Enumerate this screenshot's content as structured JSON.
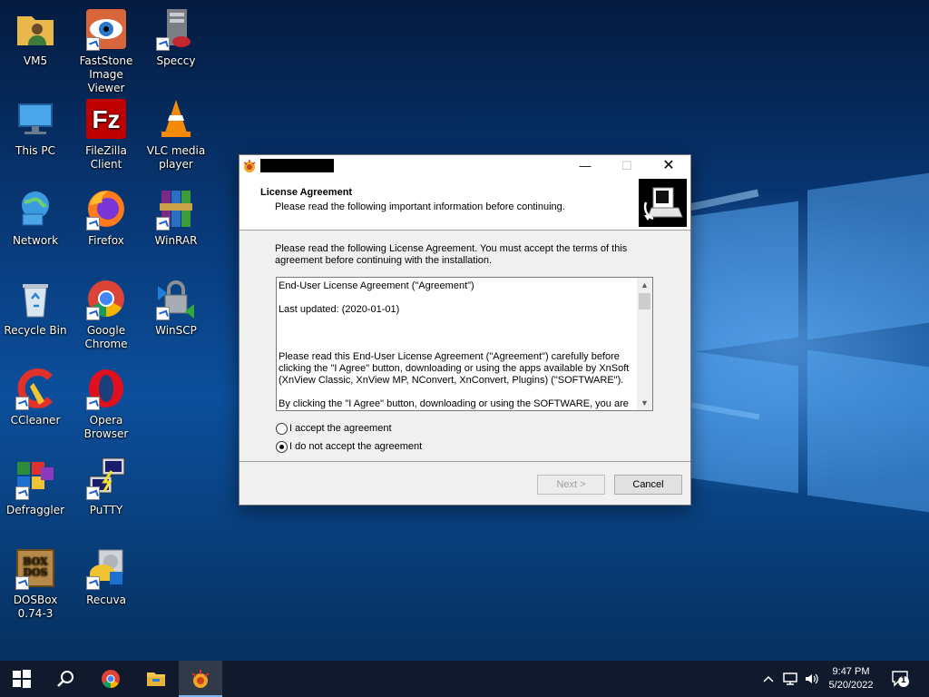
{
  "desktop_icons": [
    {
      "label": "VM5",
      "icon": "folder-user-icon"
    },
    {
      "label": "FastStone\nImage Viewer",
      "icon": "faststone-eye-icon"
    },
    {
      "label": "Speccy",
      "icon": "speccy-icon"
    },
    {
      "label": "This PC",
      "icon": "this-pc-icon"
    },
    {
      "label": "FileZilla Client",
      "icon": "filezilla-icon"
    },
    {
      "label": "VLC media\nplayer",
      "icon": "vlc-cone-icon"
    },
    {
      "label": "Network",
      "icon": "network-globe-icon"
    },
    {
      "label": "Firefox",
      "icon": "firefox-icon"
    },
    {
      "label": "WinRAR",
      "icon": "winrar-books-icon"
    },
    {
      "label": "Recycle Bin",
      "icon": "recycle-bin-icon"
    },
    {
      "label": "Google\nChrome",
      "icon": "chrome-icon"
    },
    {
      "label": "WinSCP",
      "icon": "winscp-lock-icon"
    },
    {
      "label": "CCleaner",
      "icon": "ccleaner-icon"
    },
    {
      "label": "Opera\nBrowser",
      "icon": "opera-icon"
    },
    {
      "label": "Defraggler",
      "icon": "defraggler-icon"
    },
    {
      "label": "PuTTY",
      "icon": "putty-icon"
    },
    {
      "label": "DOSBox\n0.74-3",
      "icon": "dosbox-icon"
    },
    {
      "label": "Recuva",
      "icon": "recuva-icon"
    }
  ],
  "installer": {
    "title_redacted": true,
    "header_title": "License Agreement",
    "header_subtitle": "Please read the following important information before continuing.",
    "intro": "Please read the following License Agreement. You must accept the terms of this agreement before continuing with the installation.",
    "license_paragraphs": [
      "End-User License Agreement (\"Agreement\")",
      "Last updated: (2020-01-01)",
      "",
      "Please read this End-User License Agreement (\"Agreement\") carefully before clicking the \"I Agree\" button, downloading or using the apps available by XnSoft (XnView Classic, XnView MP, NConvert, XnConvert, Plugins) (\"SOFTWARE\").",
      "By clicking the \"I Agree\" button, downloading or using the SOFTWARE, you are agreeing to be bound by the terms and conditions of this Agreement."
    ],
    "radio_accept": "I accept the agreement",
    "radio_decline": "I do not accept the agreement",
    "selected_option": "decline",
    "next_label": "Next >",
    "cancel_label": "Cancel",
    "close_glyph": "✕",
    "minimize_glyph": "—",
    "maximize_glyph": "☐"
  },
  "taskbar": {
    "items": [
      "start-icon",
      "search-icon",
      "chrome-icon",
      "file-explorer-icon",
      "installer-app-icon"
    ],
    "time": "9:47 PM",
    "date": "5/20/2022",
    "notification_count": "1"
  }
}
